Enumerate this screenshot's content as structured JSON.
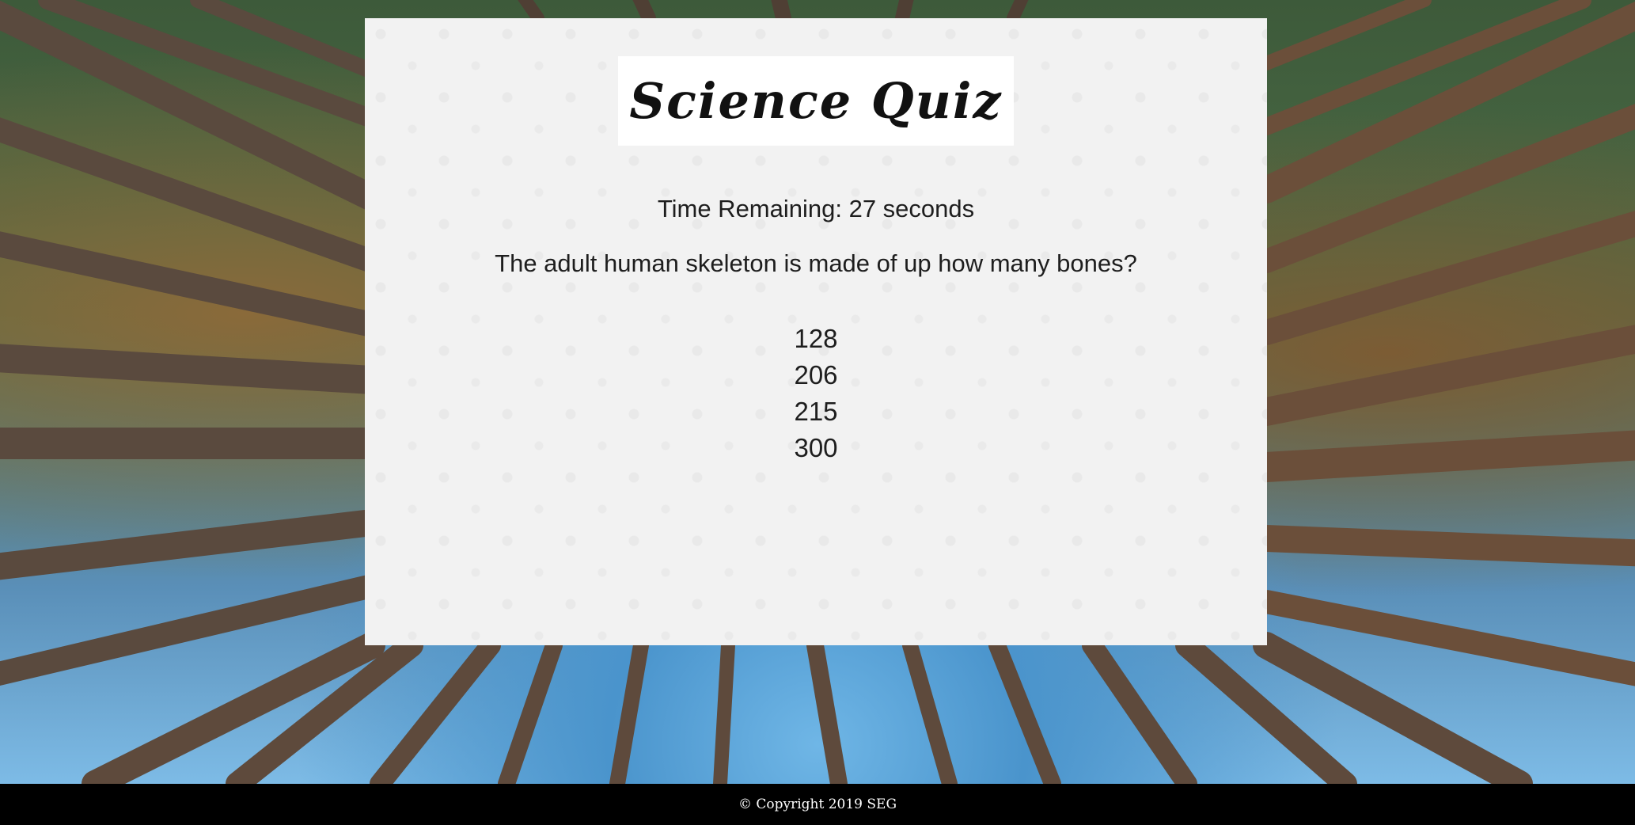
{
  "quiz": {
    "title": "Science Quiz",
    "timer_text": "Time Remaining: 27 seconds",
    "question": "The adult human skeleton is made of up how many bones?",
    "answers": [
      "128",
      "206",
      "215",
      "300"
    ]
  },
  "footer": {
    "copyright": "© Copyright 2019 SEG"
  },
  "colors": {
    "panel_bg": "#f2f2f2",
    "footer_bg": "#000000",
    "text": "#1e1e1e"
  }
}
